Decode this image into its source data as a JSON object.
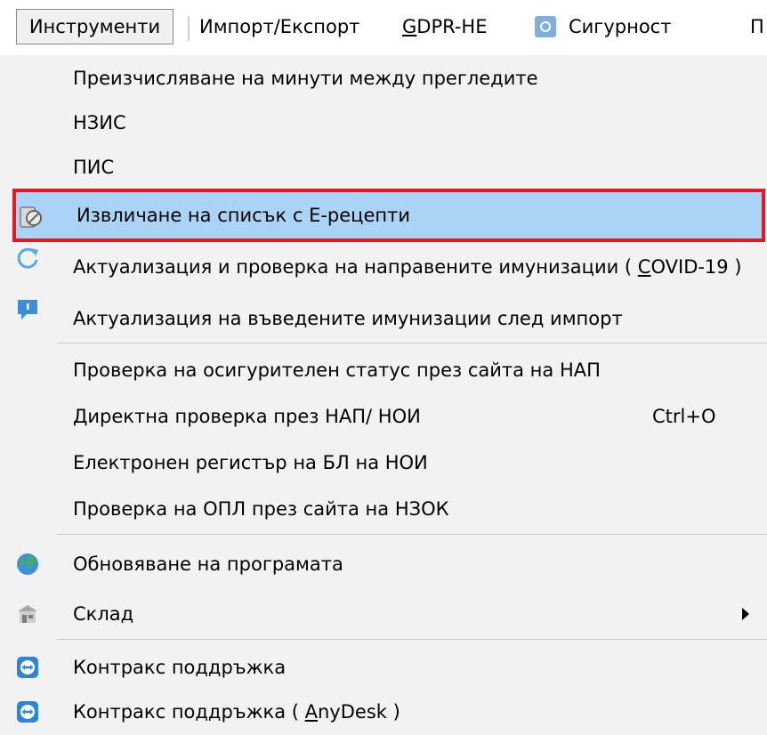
{
  "menubar": {
    "items": [
      {
        "label": "Инструменти"
      },
      {
        "label_pre": "Импорт/Експорт"
      },
      {
        "label_u": "G",
        "label_post": "DPR-НЕ"
      },
      {
        "label": "Сигурност"
      },
      {
        "label": "П"
      }
    ]
  },
  "menu": {
    "items": [
      {
        "label": "Преизчисляване на минути между прегледите"
      },
      {
        "label": "НЗИС"
      },
      {
        "label": "ПИС"
      },
      {
        "label": "Извличане на списък с Е-рецепти",
        "icon": "no-receipt-icon",
        "highlighted": true
      },
      {
        "label_pre": "Актуализация и проверка на направените имунизации ( ",
        "label_u": "C",
        "label_post": "OVID-19 )",
        "icon": "refresh-icon"
      },
      {
        "label": "Актуализация на въведените имунизации след импорт",
        "icon": "chat-bubble-icon"
      },
      {
        "label": "Проверка на осигурителен статус през сайта на  НАП"
      },
      {
        "label": "Директна проверка през НАП/ НОИ",
        "shortcut": "Ctrl+O"
      },
      {
        "label": "Електронен регистър на БЛ на НОИ"
      },
      {
        "label": "Проверка на ОПЛ през сайта на НЗОК"
      },
      {
        "label": "Обновяване на програмата",
        "icon": "globe-icon"
      },
      {
        "label": "Склад",
        "icon": "warehouse-icon",
        "has_submenu": true
      },
      {
        "label": "Контракс поддръжка",
        "icon": "teamviewer-icon"
      },
      {
        "label_pre": "Контракс поддръжка ( ",
        "label_u": "A",
        "label_post": "nyDesk )",
        "icon": "teamviewer-icon"
      }
    ]
  },
  "colors": {
    "highlight_bg": "#a9d4f5",
    "highlight_border": "#e81720",
    "menu_bg": "#f2f2f2"
  }
}
